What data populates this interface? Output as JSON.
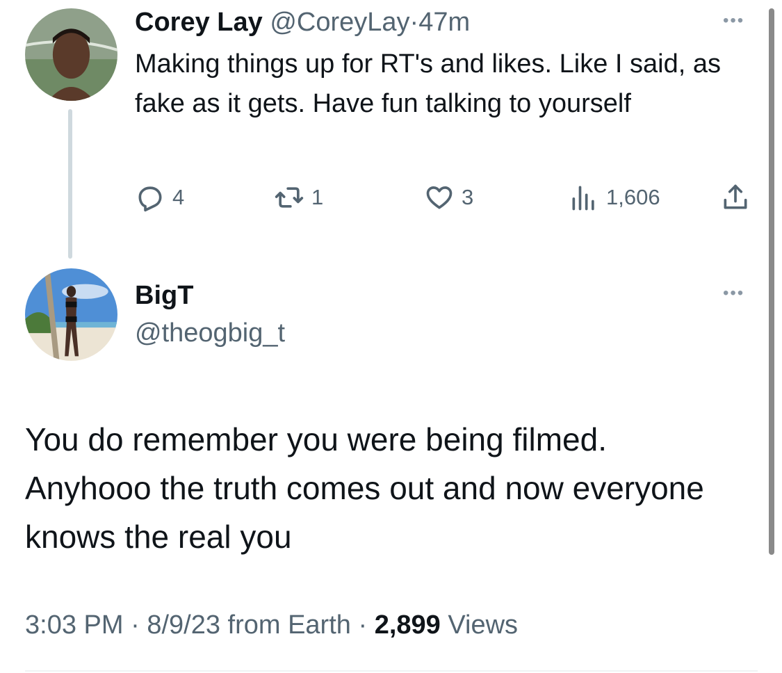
{
  "parent_tweet": {
    "name": "Corey Lay",
    "handle": "@CoreyLay",
    "separator": "·",
    "time": "47m",
    "text": "Making things up for RT's and likes. Like I said, as fake as it gets. Have fun talking to yourself",
    "replies": "4",
    "retweets": "1",
    "likes": "3",
    "views": "1,606",
    "avatar_icon": "person-avatar"
  },
  "main_tweet": {
    "name": "BigT",
    "handle": "@theogbig_t",
    "text": "You do remember you were being filmed. Anyhooo the truth comes out and now everyone knows the real you",
    "time": "3:03 PM",
    "sep1": "·",
    "date": "8/9/23 from Earth",
    "sep2": "·",
    "view_count": "2,899",
    "views_label": "Views",
    "avatar_icon": "beach-photo-avatar"
  },
  "more_label": "•••",
  "icons": {
    "reply": "reply-icon",
    "retweet": "retweet-icon",
    "like": "heart-icon",
    "views": "views-icon",
    "share": "share-icon"
  },
  "colors": {
    "text": "#0f1419",
    "secondary": "#536471",
    "thread_line": "#cfd9de"
  }
}
